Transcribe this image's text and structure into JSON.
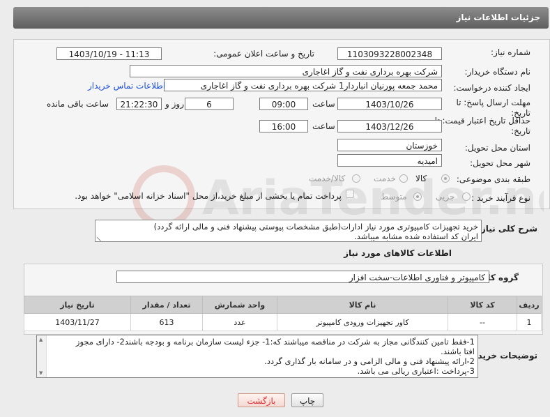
{
  "header": {
    "title": "جزئیات اطلاعات نیاز"
  },
  "form": {
    "need_number_label": "شماره نیاز:",
    "need_number": "1103093228002348",
    "announce_label": "تاریخ و ساعت اعلان عمومی:",
    "announce_value": "1403/10/19 - 11:13",
    "buyer_org_label": "نام دستگاه خریدار:",
    "buyer_org": "شرکت بهره برداری نفت و گاز اغاجاری",
    "creator_label": "ایجاد کننده درخواست:",
    "creator": "محمد جمعه پورنیان انباردار1 شرکت بهره برداری نفت و گاز اغاجاری",
    "contact_link": "اطلاعات تماس خریدار",
    "reply_deadline_label_1": "مهلت ارسال پاسخ: تا",
    "reply_deadline_label_2": "تاریخ:",
    "reply_date": "1403/10/26",
    "time_label": "ساعت",
    "reply_time": "09:00",
    "days_value": "6",
    "days_label": "روز و",
    "remaining_time": "21:22:30",
    "remaining_label": "ساعت باقی مانده",
    "price_deadline_label_1": "حداقل تاریخ اعتبار قیمت: تا",
    "price_deadline_label_2": "تاریخ:",
    "price_date": "1403/12/26",
    "price_time": "16:00",
    "province_label": "استان محل تحویل:",
    "province": "خوزستان",
    "city_label": "شهر محل تحویل:",
    "city": "امیدیه",
    "category_label": "طبقه بندی موضوعی:",
    "category_options": [
      "کالا",
      "خدمت",
      "کالا/خدمت"
    ],
    "category_selected": "کالا",
    "process_label": "نوع فرآیند خرید :",
    "process_options": [
      "جزیی",
      "متوسط"
    ],
    "payment_note": "پرداخت تمام یا بخشی از مبلغ خرید،از محل \"اسناد خزانه اسلامی\" خواهد بود."
  },
  "description": {
    "label": "شرح کلی نیاز:",
    "text_line1": "خرید تجهیزات کامپیوتری مورد نیاز ادارات(طبق مشخصات پیوستی پیشنهاد فنی و مالی ارائه گردد)",
    "text_line2": "ایران کد استفاده شده مشابه میباشد."
  },
  "goods": {
    "section_title": "اطلاعات کالاهای مورد نیاز",
    "group_label": "گروه کالا:",
    "group_value": "کامپیوتر و فناوری اطلاعات-سخت افزار",
    "columns": [
      "ردیف",
      "کد کالا",
      "نام کالا",
      "واحد شمارش",
      "تعداد / مقدار",
      "تاریخ نیاز"
    ],
    "rows": [
      {
        "row": "1",
        "code": "--",
        "name": "کاور تجهیزات ورودی کامپیوتر",
        "unit": "عدد",
        "qty": "613",
        "date": "1403/11/27"
      }
    ]
  },
  "buyer_notes": {
    "label": "توضیحات خریدار:",
    "line1": "1-فقط تامین کنندگانی مجاز به شرکت در مناقصه میباشند که:1- جزء لیست سازمان برنامه و بودجه باشند2- دارای مجوز",
    "line2": "افتا باشند.",
    "line3": "2-ارائه پیشنهاد فنی و مالی الزامی و در سامانه بار گذاری گردد.",
    "line4": "3-پرداخت :اعتباری ریالی  می باشد."
  },
  "buttons": {
    "print": "چاپ",
    "back": "بازگشت"
  },
  "watermark": {
    "text": "AriaTender.neT"
  }
}
